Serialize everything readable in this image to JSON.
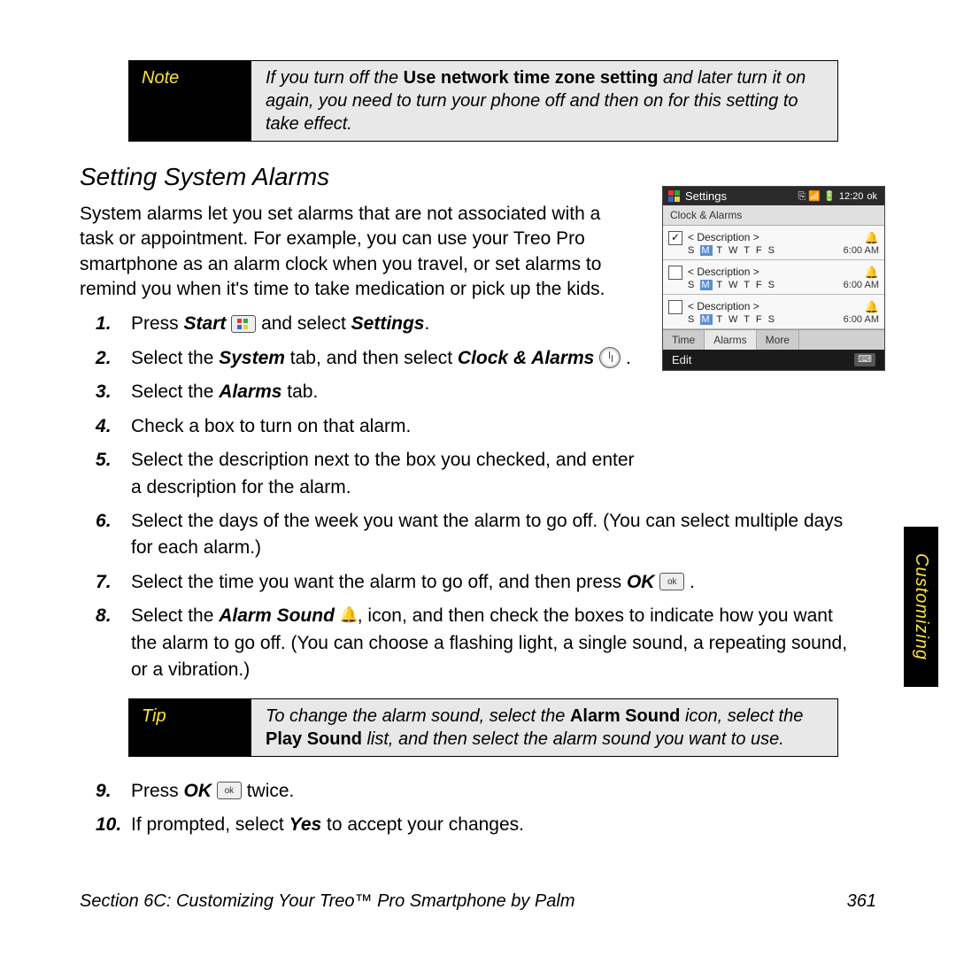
{
  "note_box": {
    "label": "Note",
    "body_pre": "If you turn off the ",
    "body_bold": "Use network time zone setting",
    "body_post": " and later turn it on again, you need to turn your phone off and then on for this setting to take effect."
  },
  "section_title": "Setting System Alarms",
  "intro": "System alarms let you set alarms that are not associated with a task or appointment. For example, you can use your Treo Pro smartphone as an alarm clock when you travel, or set alarms to remind you when it's time to take medication or pick up the kids.",
  "steps": {
    "s1_a": "Press ",
    "s1_b": "Start",
    "s1_c": " and select ",
    "s1_d": "Settings",
    "s1_e": ".",
    "s2_a": "Select the ",
    "s2_b": "System",
    "s2_c": " tab, and then select ",
    "s2_d": "Clock & Alarms",
    "s2_e": " .",
    "s3_a": "Select the ",
    "s3_b": "Alarms",
    "s3_c": " tab.",
    "s4": "Check a box to turn on that alarm.",
    "s5": "Select the description next to the box you checked, and enter a description for the alarm.",
    "s6": "Select the days of the week you want the alarm to go off. (You can select multiple days for each alarm.)",
    "s7_a": "Select the time you want the alarm to go off, and then press ",
    "s7_b": "OK",
    "s7_c": " .",
    "s8_a": "Select the ",
    "s8_b": "Alarm Sound",
    "s8_c": ", icon, and then check the boxes to indicate how you want the alarm to go off. (You can choose a flashing light, a single sound, a repeating sound, or a vibration.)",
    "s9_a": "Press ",
    "s9_b": "OK",
    "s9_c": " twice.",
    "s10_a": "If prompted, select ",
    "s10_b": "Yes",
    "s10_c": " to accept your changes."
  },
  "tip_box": {
    "label": "Tip",
    "line1_pre": "To change the alarm sound, select the ",
    "line1_bold": "Alarm Sound",
    "line1_post": " icon, select the",
    "line2_bold": "Play Sound",
    "line2_post": " list, and then select the alarm sound you want to use."
  },
  "screenshot": {
    "title": "Settings",
    "status_icons": "⎘ 📶 🔋",
    "clock": "12:20",
    "ok": "ok",
    "subtitle": "Clock & Alarms",
    "rows": [
      {
        "checked": true,
        "desc": "< Description >",
        "days": {
          "pre": "S ",
          "hl": "M",
          "post": " T W T F S"
        },
        "time": "6:00 AM"
      },
      {
        "checked": false,
        "desc": "< Description >",
        "days": {
          "pre": "S ",
          "hl": "M",
          "post": " T W T F S"
        },
        "time": "6:00 AM"
      },
      {
        "checked": false,
        "desc": "< Description >",
        "days": {
          "pre": "S ",
          "hl": "M",
          "post": " T W T F S"
        },
        "time": "6:00 AM"
      }
    ],
    "tabs": [
      "Time",
      "Alarms",
      "More"
    ],
    "active_tab_index": 1,
    "menubar_left": "Edit",
    "menubar_kb": "⌨"
  },
  "side_tab": "Customizing",
  "footer": {
    "left": "Section 6C: Customizing Your Treo™ Pro Smartphone by Palm",
    "right": "361"
  }
}
